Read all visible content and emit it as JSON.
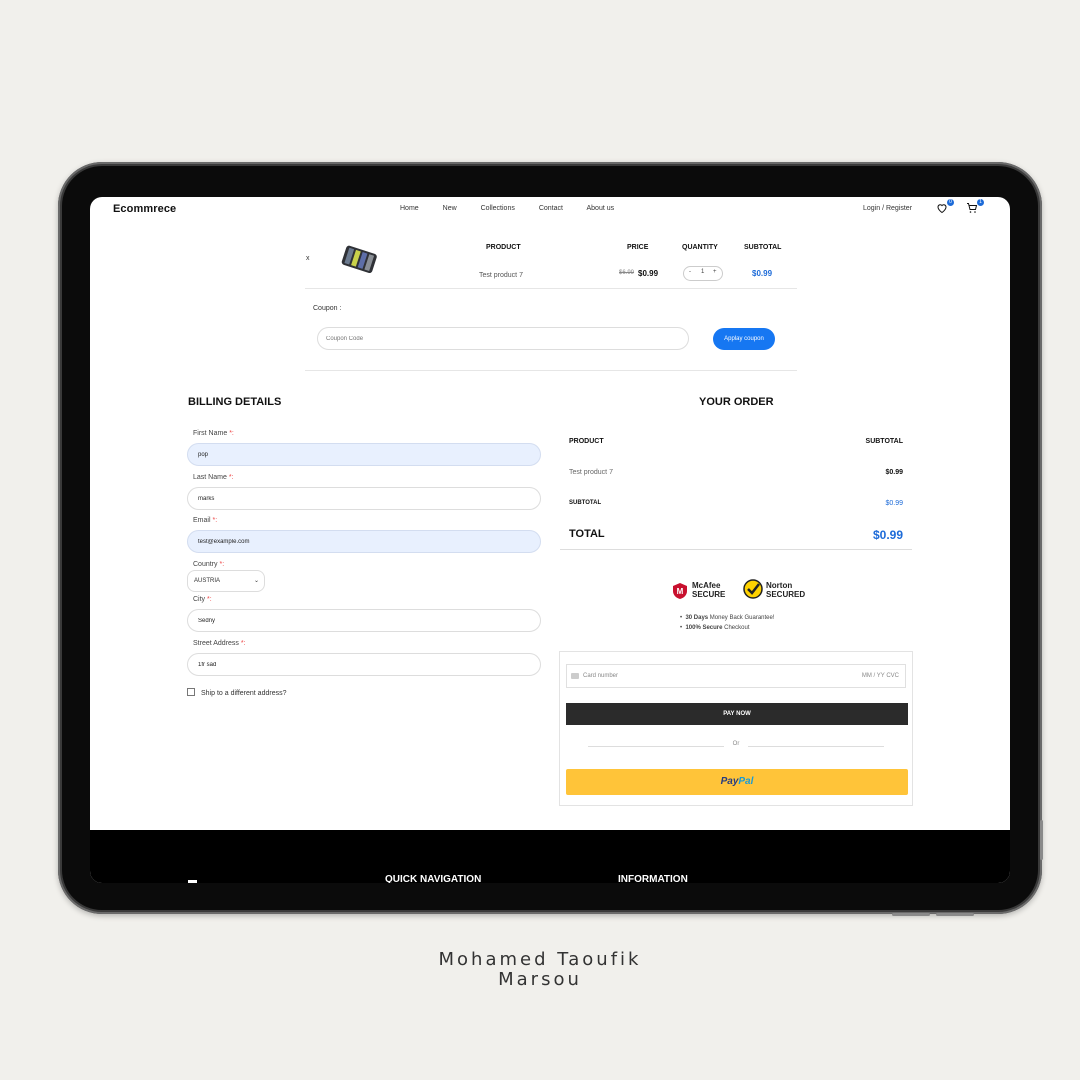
{
  "header": {
    "logo": "Ecommrece",
    "nav": [
      "Home",
      "New",
      "Collections",
      "Contact",
      "About us"
    ],
    "login": "Login / Register",
    "wishlist_count": "0",
    "cart_count": "1"
  },
  "cart": {
    "remove": "x",
    "headers": {
      "product": "PRODUCT",
      "price": "PRICE",
      "quantity": "QUANTITY",
      "subtotal": "SUBTOTAL"
    },
    "item": {
      "name": "Test product 7",
      "old_price": "$6.99",
      "price": "$0.99",
      "qty": "1",
      "minus": "-",
      "plus": "+",
      "subtotal": "$0.99"
    },
    "coupon_label": "Coupon :",
    "coupon_placeholder": "Coupon Code",
    "coupon_button": "Applay coupon"
  },
  "billing": {
    "title": "BILLING DETAILS",
    "first_name_label": "First Name",
    "first_name": "pop",
    "last_name_label": "Last Name",
    "last_name": "marks",
    "email_label": "Email",
    "email": "test@example.com",
    "country_label": "Country",
    "country": "AUSTRIA",
    "city_label": "City",
    "city": "Sedny",
    "street_label": "Street Address",
    "street": "1fr sad",
    "required_mark": "*:",
    "ship_label": "Ship to a different address?"
  },
  "order": {
    "title": "YOUR ORDER",
    "product_header": "PRODUCT",
    "subtotal_header": "SUBTOTAL",
    "item_name": "Test product 7",
    "item_price": "$0.99",
    "subtotal_label": "SUBTOTAL",
    "subtotal_value": "$0.99",
    "total_label": "TOTAL",
    "total_value": "$0.99",
    "mcafee": "McAfee SECURE",
    "norton": "Norton SECURED",
    "guarantee_1_bold": "30 Days",
    "guarantee_1": " Money Back Guarantee!",
    "guarantee_2_bold": "100% Secure",
    "guarantee_2": " Checkout",
    "card_placeholder": "Card number",
    "card_date": "MM / YY  CVC",
    "pay_now": "PAY NOW",
    "or": "Or",
    "paypal_pay": "Pay",
    "paypal_pal": "Pal"
  },
  "footer": {
    "col1": "QUICK NAVIGATION",
    "col2": "INFORMATION"
  },
  "caption": {
    "line1": "Mohamed Taoufik",
    "line2": "Marsou"
  },
  "colors": {
    "accent": "#1677f2",
    "paypal": "#ffc439",
    "dark": "#2b2b2b"
  }
}
